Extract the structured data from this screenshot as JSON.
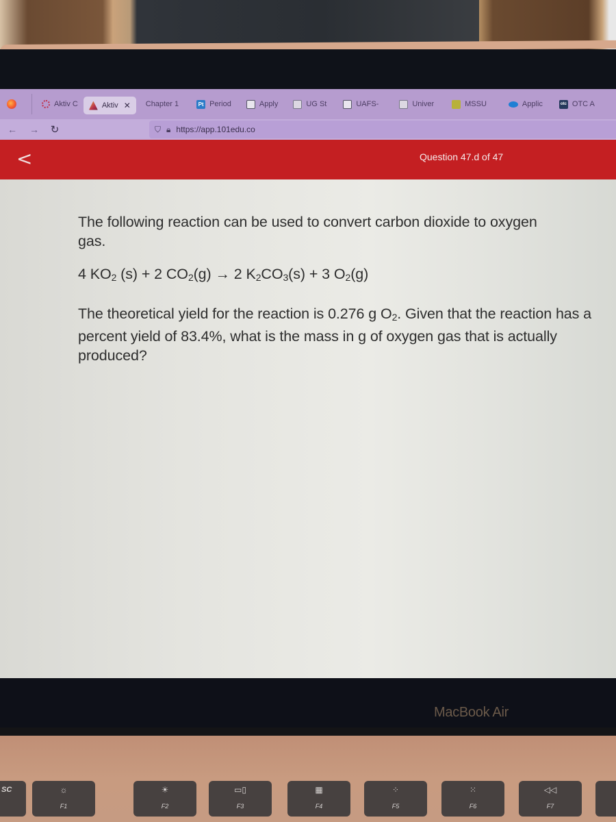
{
  "browser": {
    "tabs": [
      {
        "label": "Aktiv C",
        "icon": "aktiv-gear-icon",
        "active": false
      },
      {
        "label": "Aktiv",
        "icon": "aktiv-logo-icon",
        "active": true,
        "close": "✕"
      },
      {
        "label": "Chapter 1",
        "icon": "",
        "active": false
      },
      {
        "label": "Period",
        "icon": "pt-icon",
        "active": false
      },
      {
        "label": "Apply",
        "icon": "crest-icon",
        "active": false
      },
      {
        "label": "UG St",
        "icon": "university-icon",
        "active": false
      },
      {
        "label": "UAFS-",
        "icon": "crest-icon",
        "active": false
      },
      {
        "label": "Univer",
        "icon": "university-icon",
        "active": false
      },
      {
        "label": "MSSU",
        "icon": "mssu-icon",
        "active": false
      },
      {
        "label": "Applic",
        "icon": "salesforce-cloud-icon",
        "active": false
      },
      {
        "label": "OTC A",
        "icon": "otc-icon",
        "active": false
      }
    ],
    "pt_icon_text": "Pt",
    "otc_icon_text": "otc",
    "nav": {
      "back": "←",
      "forward": "→",
      "reload": "C"
    },
    "url": "https://app.101edu.co"
  },
  "app": {
    "back_glyph": "<",
    "question_counter": "Question 47.d of 47",
    "intro": "The following reaction can be used to convert carbon dioxide to oxygen gas.",
    "equation": {
      "parts": [
        "4 KO",
        "2",
        " (s) + 2 CO",
        "2",
        "(g) → 2 K",
        "2",
        "CO",
        "3",
        "(s) + 3 O",
        "2",
        "(g)"
      ]
    },
    "question": {
      "before": "The theoretical yield for the reaction is 0.276 g O",
      "sub": "2",
      "after": ". Given that the reaction has a percent yield of 83.4%, what is the mass in g of oxygen gas that is actually produced?"
    },
    "header_color": "#c41f22"
  },
  "device": {
    "brand": "MacBook Air",
    "keys": [
      {
        "label": "SC",
        "glyph": ""
      },
      {
        "label": "F1",
        "glyph": "☼"
      },
      {
        "label": "F2",
        "glyph": "☀"
      },
      {
        "label": "F3",
        "glyph": "▭▯"
      },
      {
        "label": "F4",
        "glyph": "▦"
      },
      {
        "label": "F5",
        "glyph": "⁘"
      },
      {
        "label": "F6",
        "glyph": "⁙"
      },
      {
        "label": "F7",
        "glyph": "◁◁"
      }
    ]
  }
}
